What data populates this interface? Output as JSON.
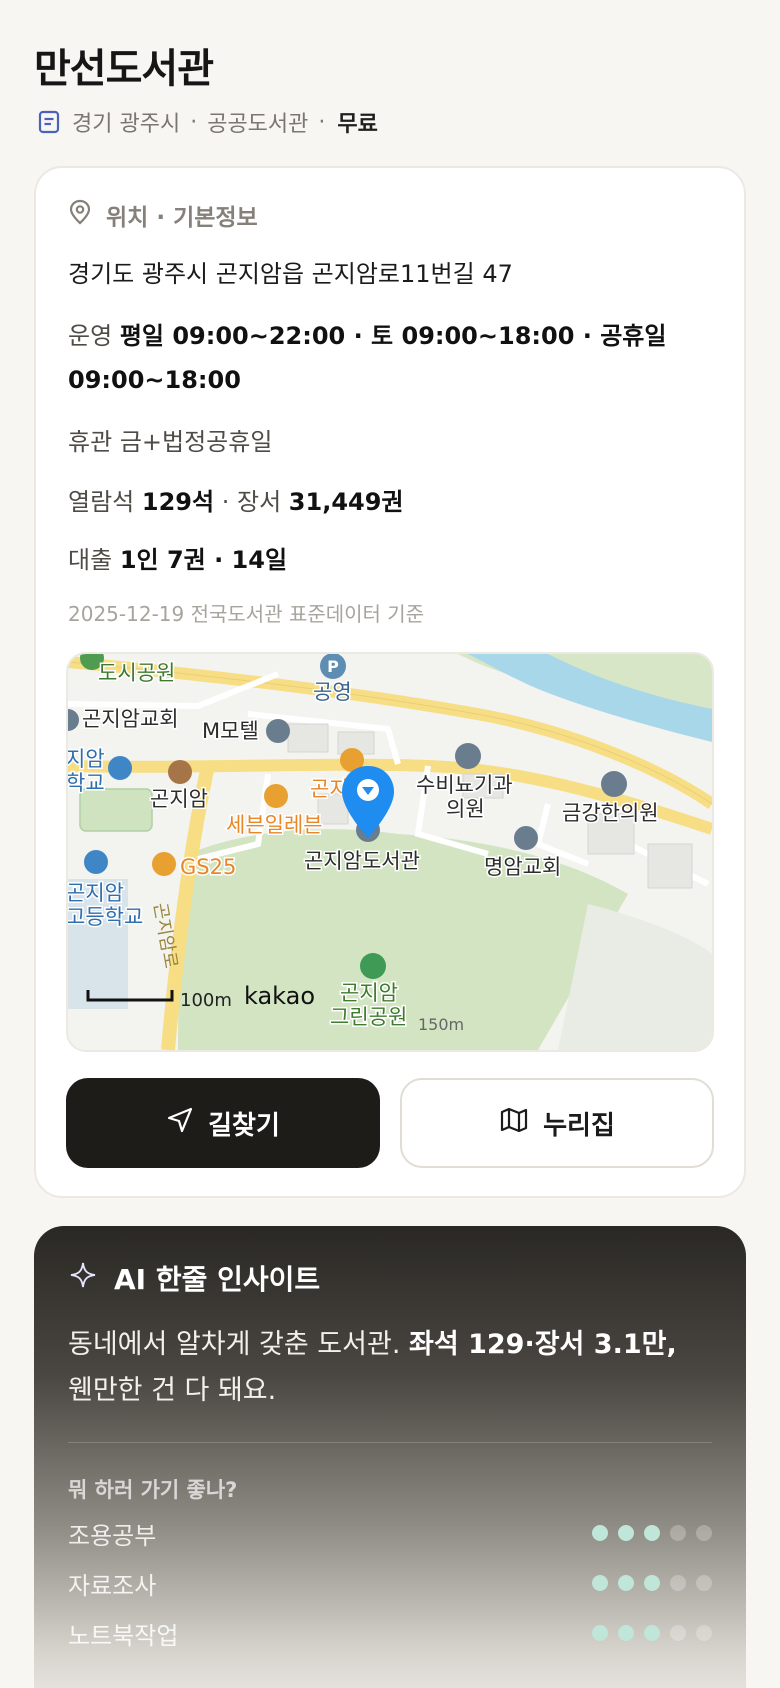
{
  "header": {
    "title": "만선도서관",
    "region": "경기 광주시",
    "category": "공공도서관",
    "separator": "·",
    "fee": "무료",
    "meta_icon": "document-icon"
  },
  "info": {
    "section_title": "위치 · 기본정보",
    "section_icon": "location-pin-icon",
    "address": "경기도 광주시 곤지암읍 곤지암로11번길 47",
    "hours_label": "운영",
    "hours_value": "평일 09:00~22:00 · 토 09:00~18:00 · 공휴일 09:00~18:00",
    "closed_label": "휴관",
    "closed_value": "금+법정공휴일",
    "seats_label": "열람석",
    "seats_value": "129석",
    "books_label": "장서",
    "books_value": "31,449권",
    "loan_label": "대출",
    "loan_value": "1인 7권 · 14일",
    "data_basis": "2025-12-19 전국도서관 표준데이터 기준"
  },
  "map": {
    "labels": {
      "park_top": "도시공원",
      "parking": "P",
      "public": "공영",
      "church1": "곤지암교회",
      "motel": "M모텔",
      "school1a": "지암",
      "school1b": "학교",
      "gonjiam": "곤지암",
      "conv_partial": "곤지",
      "seven": "세븐일레븐",
      "clinic_ent_a": "수비뇨기과",
      "clinic_ent_b": "의원",
      "clinic_kr": "금강한의원",
      "library": "곤지암도서관",
      "church2": "명암교회",
      "gs25": "GS25",
      "school2a": "곤지암",
      "school2b": "고등학교",
      "road": "곤지암로",
      "park_bottom_a": "곤지암",
      "park_bottom_b": "그린공원",
      "scale": "100m",
      "brand": "kakao",
      "dist": "150m"
    },
    "colors": {
      "pin": "#1f8cf0",
      "road": "#f7de85",
      "park": "#d3e4c2",
      "river": "#a8d7ea",
      "orange": "#e8872a"
    }
  },
  "actions": {
    "directions_label": "길찾기",
    "directions_icon": "navigation-arrow-icon",
    "nurijip_label": "누리집",
    "nurijip_icon": "map-fold-icon"
  },
  "ai": {
    "title": "AI 한줄 인사이트",
    "icon": "sparkle-icon",
    "summary_plain": "동네에서 알차게 갖춘 도서관.",
    "summary_bold": "좌석 129·장서 3.1만,",
    "summary_tail": "웬만한 건 다 돼요.",
    "question": "뭐 하러 가기 좋나?",
    "ratings": [
      {
        "label": "조용공부",
        "score": 3,
        "max": 5
      },
      {
        "label": "자료조사",
        "score": 3,
        "max": 5
      },
      {
        "label": "노트북작업",
        "score": 3,
        "max": 5
      }
    ]
  }
}
